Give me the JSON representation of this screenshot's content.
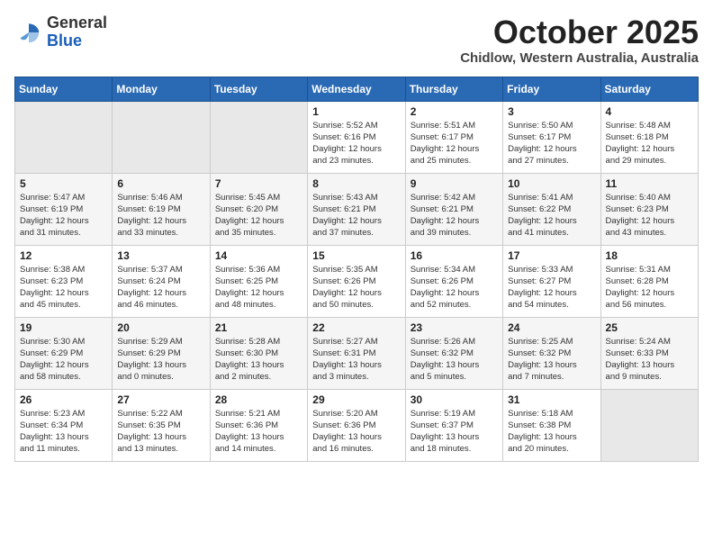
{
  "logo": {
    "general": "General",
    "blue": "Blue"
  },
  "header": {
    "title": "October 2025",
    "subtitle": "Chidlow, Western Australia, Australia"
  },
  "weekdays": [
    "Sunday",
    "Monday",
    "Tuesday",
    "Wednesday",
    "Thursday",
    "Friday",
    "Saturday"
  ],
  "weeks": [
    [
      {
        "day": "",
        "info": ""
      },
      {
        "day": "",
        "info": ""
      },
      {
        "day": "",
        "info": ""
      },
      {
        "day": "1",
        "info": "Sunrise: 5:52 AM\nSunset: 6:16 PM\nDaylight: 12 hours\nand 23 minutes."
      },
      {
        "day": "2",
        "info": "Sunrise: 5:51 AM\nSunset: 6:17 PM\nDaylight: 12 hours\nand 25 minutes."
      },
      {
        "day": "3",
        "info": "Sunrise: 5:50 AM\nSunset: 6:17 PM\nDaylight: 12 hours\nand 27 minutes."
      },
      {
        "day": "4",
        "info": "Sunrise: 5:48 AM\nSunset: 6:18 PM\nDaylight: 12 hours\nand 29 minutes."
      }
    ],
    [
      {
        "day": "5",
        "info": "Sunrise: 5:47 AM\nSunset: 6:19 PM\nDaylight: 12 hours\nand 31 minutes."
      },
      {
        "day": "6",
        "info": "Sunrise: 5:46 AM\nSunset: 6:19 PM\nDaylight: 12 hours\nand 33 minutes."
      },
      {
        "day": "7",
        "info": "Sunrise: 5:45 AM\nSunset: 6:20 PM\nDaylight: 12 hours\nand 35 minutes."
      },
      {
        "day": "8",
        "info": "Sunrise: 5:43 AM\nSunset: 6:21 PM\nDaylight: 12 hours\nand 37 minutes."
      },
      {
        "day": "9",
        "info": "Sunrise: 5:42 AM\nSunset: 6:21 PM\nDaylight: 12 hours\nand 39 minutes."
      },
      {
        "day": "10",
        "info": "Sunrise: 5:41 AM\nSunset: 6:22 PM\nDaylight: 12 hours\nand 41 minutes."
      },
      {
        "day": "11",
        "info": "Sunrise: 5:40 AM\nSunset: 6:23 PM\nDaylight: 12 hours\nand 43 minutes."
      }
    ],
    [
      {
        "day": "12",
        "info": "Sunrise: 5:38 AM\nSunset: 6:23 PM\nDaylight: 12 hours\nand 45 minutes."
      },
      {
        "day": "13",
        "info": "Sunrise: 5:37 AM\nSunset: 6:24 PM\nDaylight: 12 hours\nand 46 minutes."
      },
      {
        "day": "14",
        "info": "Sunrise: 5:36 AM\nSunset: 6:25 PM\nDaylight: 12 hours\nand 48 minutes."
      },
      {
        "day": "15",
        "info": "Sunrise: 5:35 AM\nSunset: 6:26 PM\nDaylight: 12 hours\nand 50 minutes."
      },
      {
        "day": "16",
        "info": "Sunrise: 5:34 AM\nSunset: 6:26 PM\nDaylight: 12 hours\nand 52 minutes."
      },
      {
        "day": "17",
        "info": "Sunrise: 5:33 AM\nSunset: 6:27 PM\nDaylight: 12 hours\nand 54 minutes."
      },
      {
        "day": "18",
        "info": "Sunrise: 5:31 AM\nSunset: 6:28 PM\nDaylight: 12 hours\nand 56 minutes."
      }
    ],
    [
      {
        "day": "19",
        "info": "Sunrise: 5:30 AM\nSunset: 6:29 PM\nDaylight: 12 hours\nand 58 minutes."
      },
      {
        "day": "20",
        "info": "Sunrise: 5:29 AM\nSunset: 6:29 PM\nDaylight: 13 hours\nand 0 minutes."
      },
      {
        "day": "21",
        "info": "Sunrise: 5:28 AM\nSunset: 6:30 PM\nDaylight: 13 hours\nand 2 minutes."
      },
      {
        "day": "22",
        "info": "Sunrise: 5:27 AM\nSunset: 6:31 PM\nDaylight: 13 hours\nand 3 minutes."
      },
      {
        "day": "23",
        "info": "Sunrise: 5:26 AM\nSunset: 6:32 PM\nDaylight: 13 hours\nand 5 minutes."
      },
      {
        "day": "24",
        "info": "Sunrise: 5:25 AM\nSunset: 6:32 PM\nDaylight: 13 hours\nand 7 minutes."
      },
      {
        "day": "25",
        "info": "Sunrise: 5:24 AM\nSunset: 6:33 PM\nDaylight: 13 hours\nand 9 minutes."
      }
    ],
    [
      {
        "day": "26",
        "info": "Sunrise: 5:23 AM\nSunset: 6:34 PM\nDaylight: 13 hours\nand 11 minutes."
      },
      {
        "day": "27",
        "info": "Sunrise: 5:22 AM\nSunset: 6:35 PM\nDaylight: 13 hours\nand 13 minutes."
      },
      {
        "day": "28",
        "info": "Sunrise: 5:21 AM\nSunset: 6:36 PM\nDaylight: 13 hours\nand 14 minutes."
      },
      {
        "day": "29",
        "info": "Sunrise: 5:20 AM\nSunset: 6:36 PM\nDaylight: 13 hours\nand 16 minutes."
      },
      {
        "day": "30",
        "info": "Sunrise: 5:19 AM\nSunset: 6:37 PM\nDaylight: 13 hours\nand 18 minutes."
      },
      {
        "day": "31",
        "info": "Sunrise: 5:18 AM\nSunset: 6:38 PM\nDaylight: 13 hours\nand 20 minutes."
      },
      {
        "day": "",
        "info": ""
      }
    ]
  ]
}
